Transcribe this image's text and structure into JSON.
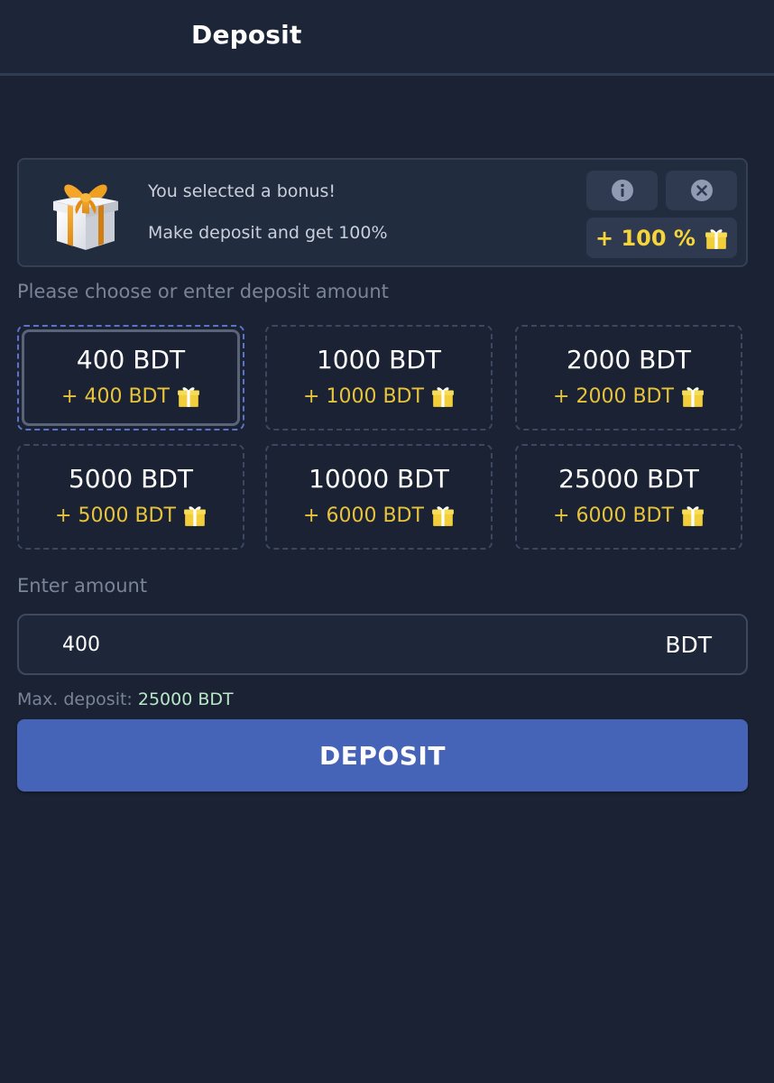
{
  "header": {
    "title": "Deposit"
  },
  "bonus": {
    "line1": "You selected a bonus!",
    "line2": "Make deposit and get 100%",
    "percent": "+ 100 %",
    "gift_icon": "gift-icon",
    "info_icon": "info-icon",
    "close_icon": "close-icon"
  },
  "amounts": {
    "label": "Please choose or enter deposit amount",
    "options": [
      {
        "value": "400 BDT",
        "bonus": "+ 400 BDT",
        "selected": true
      },
      {
        "value": "1000 BDT",
        "bonus": "+ 1000 BDT",
        "selected": false
      },
      {
        "value": "2000 BDT",
        "bonus": "+ 2000 BDT",
        "selected": false
      },
      {
        "value": "5000 BDT",
        "bonus": "+ 5000 BDT",
        "selected": false
      },
      {
        "value": "10000 BDT",
        "bonus": "+ 6000 BDT",
        "selected": false
      },
      {
        "value": "25000 BDT",
        "bonus": "+ 6000 BDT",
        "selected": false
      }
    ]
  },
  "input": {
    "label": "Enter amount",
    "value": "400",
    "currency": "BDT"
  },
  "limits": {
    "max_label": "Max. deposit:",
    "max_value": "25000 BDT"
  },
  "deposit_button": {
    "label": "DEPOSIT"
  },
  "colors": {
    "background": "#1a2233",
    "accent": "#4563b7",
    "bonus_yellow": "#e7c43c",
    "max_green": "#b8e8c8"
  }
}
